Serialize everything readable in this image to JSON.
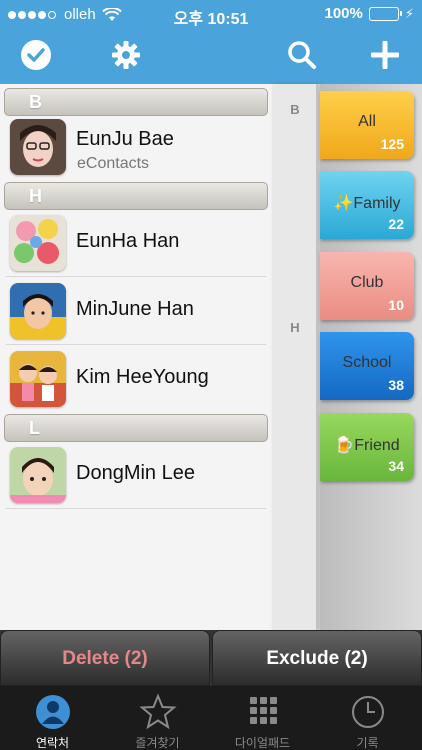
{
  "status": {
    "carrier": "olleh",
    "time": "오후 10:51",
    "battery": "100%"
  },
  "toolbar": {
    "icons": [
      "check-circle-icon",
      "gear-icon",
      "search-icon",
      "plus-icon"
    ]
  },
  "sections": [
    {
      "letter": "B"
    },
    {
      "letter": "H"
    },
    {
      "letter": "L"
    }
  ],
  "contacts": [
    {
      "name": "EunJu Bae",
      "sub": "eContacts"
    },
    {
      "name": "EunHa Han"
    },
    {
      "name": "MinJune Han"
    },
    {
      "name": "Kim HeeYoung"
    },
    {
      "name": "DongMin Lee"
    }
  ],
  "index": [
    "B",
    "H"
  ],
  "groups": [
    {
      "name": "All",
      "count": "125",
      "color": "#f2b22a"
    },
    {
      "name": "✨Family",
      "count": "22",
      "color": "#3fb8de"
    },
    {
      "name": "Club",
      "count": "10",
      "color": "#ef9d93"
    },
    {
      "name": "School",
      "count": "38",
      "color": "#1d7fd9"
    },
    {
      "name": "🍺Friend",
      "count": "34",
      "color": "#7ec64a"
    }
  ],
  "actions": {
    "delete_label": "Delete (2)",
    "exclude_label": "Exclude (2)",
    "delete_color": "#e5888a"
  },
  "tabs": [
    {
      "label": "연락처",
      "icon": "person-icon"
    },
    {
      "label": "즐겨찾기",
      "icon": "star-icon"
    },
    {
      "label": "다이얼패드",
      "icon": "dialpad-icon"
    },
    {
      "label": "기록",
      "icon": "clock-icon"
    }
  ]
}
